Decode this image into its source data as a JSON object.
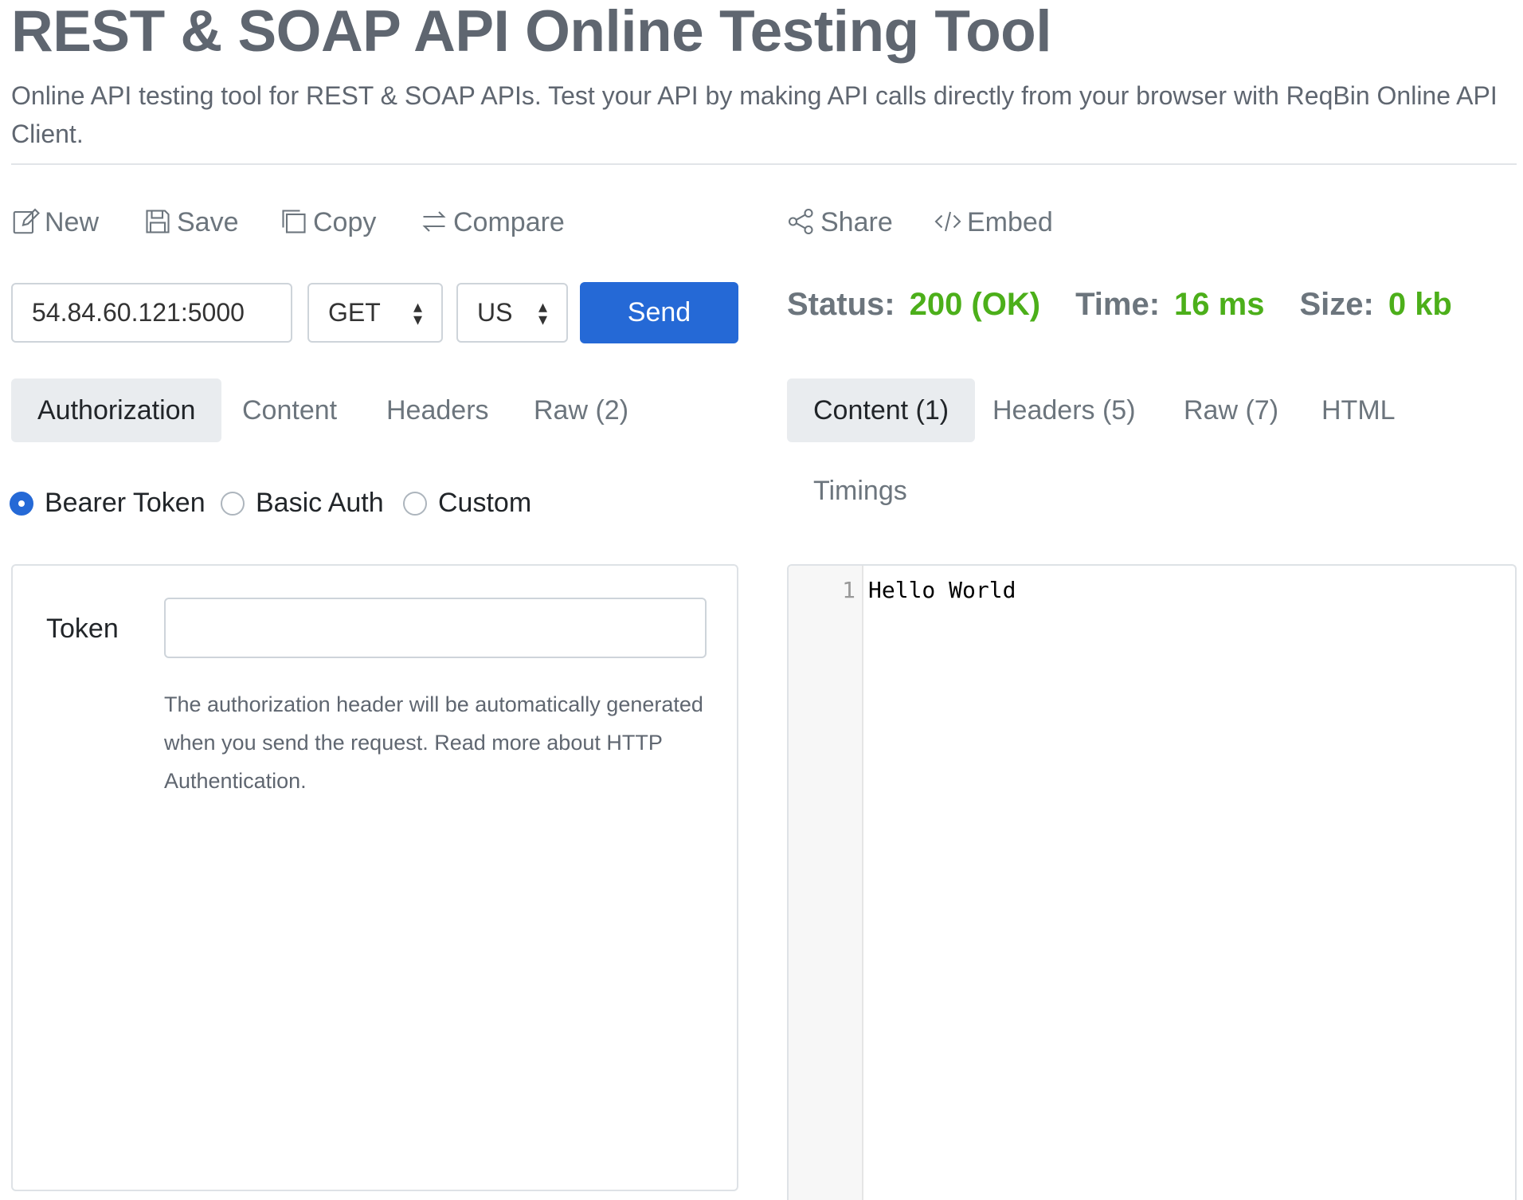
{
  "header": {
    "title": "REST & SOAP API Online Testing Tool",
    "description": "Online API testing tool for REST & SOAP APIs. Test your API by making API calls directly from your browser with ReqBin Online API Client."
  },
  "toolbar": {
    "new_label": "New",
    "save_label": "Save",
    "copy_label": "Copy",
    "compare_label": "Compare",
    "share_label": "Share",
    "embed_label": "Embed"
  },
  "request": {
    "url": "54.84.60.121:5000",
    "method": "GET",
    "region": "US",
    "send_label": "Send"
  },
  "request_tabs": [
    "Authorization",
    "Content",
    "Headers",
    "Raw (2)"
  ],
  "auth": {
    "options": [
      "Bearer Token",
      "Basic Auth",
      "Custom"
    ],
    "selected": "Bearer Token",
    "token_label": "Token",
    "token_value": "",
    "help_text": "The authorization header will be automatically generated when you send the request. Read more about HTTP Authentication."
  },
  "response": {
    "status_label": "Status:",
    "status_value": "200 (OK)",
    "time_label": "Time:",
    "time_value": "16 ms",
    "size_label": "Size:",
    "size_value": "0 kb",
    "tabs": [
      "Content (1)",
      "Headers (5)",
      "Raw (7)",
      "HTML",
      "Timings"
    ],
    "active_tab": "Content (1)",
    "line_number": "1",
    "body": "Hello World"
  },
  "colors": {
    "accent": "#2569d6",
    "status_ok": "#4caf1a",
    "muted_text": "#6c757d",
    "active_tab_bg": "#e9ecef"
  }
}
